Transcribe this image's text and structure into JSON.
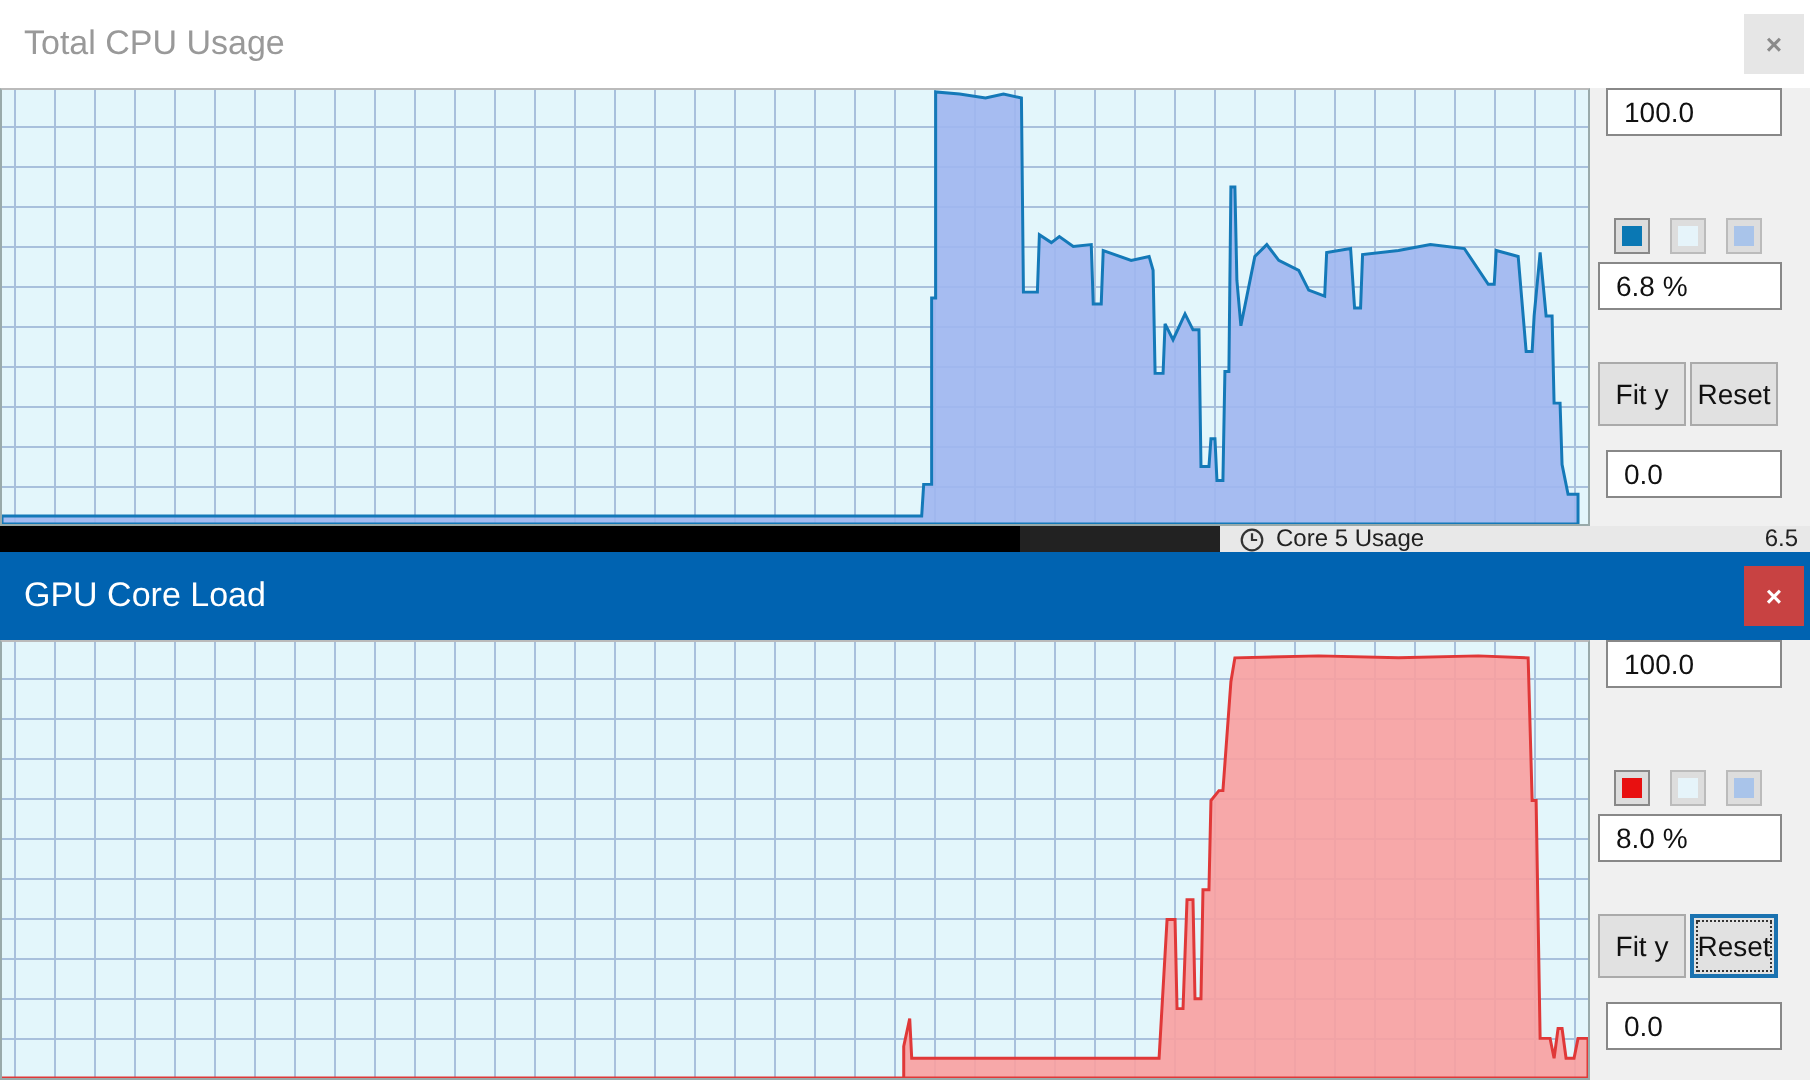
{
  "windows": [
    {
      "title": "Total CPU Usage",
      "active": false,
      "close": "×",
      "kind": "cpu",
      "y_max": "100.0",
      "swatches": [
        {
          "color": "#0a78b4",
          "selected": true
        },
        {
          "color": "#e6f4fa",
          "selected": false
        },
        {
          "color": "#a9c4ea",
          "selected": false
        }
      ],
      "current": "6.8 %",
      "buttons": [
        {
          "label": "Fit y",
          "focused": false
        },
        {
          "label": "Reset",
          "focused": false
        }
      ],
      "y_min": "0.0"
    },
    {
      "title": "GPU Core Load",
      "active": true,
      "close": "×",
      "kind": "gpu",
      "y_max": "100.0",
      "swatches": [
        {
          "color": "#e81010",
          "selected": true
        },
        {
          "color": "#e6f4fa",
          "selected": false
        },
        {
          "color": "#a9c4ea",
          "selected": false
        }
      ],
      "current": "8.0 %",
      "buttons": [
        {
          "label": "Fit y",
          "focused": false
        },
        {
          "label": "Reset",
          "focused": true
        }
      ],
      "y_min": "0.0"
    }
  ],
  "background_row": {
    "label": "Core 5 Usage",
    "value": "6.5"
  }
}
